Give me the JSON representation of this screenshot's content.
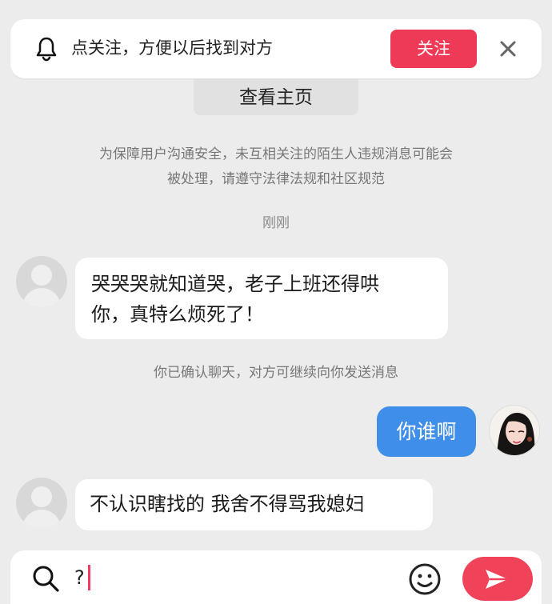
{
  "banner": {
    "bell_icon": "bell-icon",
    "message": "点关注，方便以后找到对方",
    "follow_label": "关注",
    "close_icon": "close-icon",
    "follow_color": "#ee3a57"
  },
  "profile_link": {
    "label": "查看主页"
  },
  "notice": {
    "line1": "为保障用户沟通安全，未互相关注的陌生人违规消息可能会",
    "line2": "被处理，请遵守法律法规和社区规范"
  },
  "conversation": {
    "time_label": "刚刚",
    "incoming_1": {
      "line1": "哭哭哭就知道哭，老子上班还得哄",
      "line2": "你，真特么烦死了！"
    },
    "confirm_label": "你已确认聊天，对方可继续向你发送消息",
    "outgoing_1": "你谁啊",
    "incoming_2": "不认识瞎找的 我舍不得骂我媳妇"
  },
  "composer": {
    "search_icon": "search-icon",
    "input_value": "?",
    "emoji_icon": "emoji-icon",
    "send_icon": "send-icon",
    "send_color": "#f0435a"
  }
}
